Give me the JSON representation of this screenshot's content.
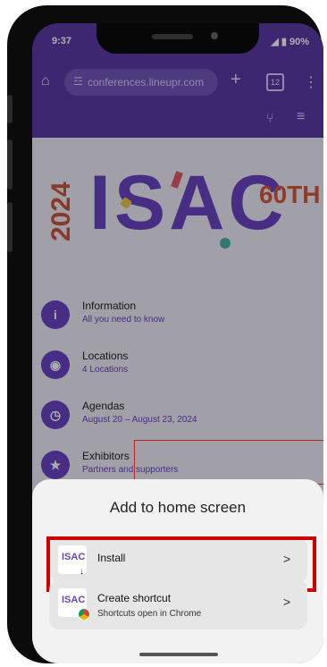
{
  "status": {
    "time": "9:37",
    "battery": "◢ ▮ 90%"
  },
  "chrome": {
    "home_icon": "⌂",
    "tune_icon": "☲",
    "url": "conferences.lineupr.com",
    "new_tab_icon": "+",
    "tab_count": "12",
    "menu_icon": "⋮"
  },
  "site": {
    "share_icon": "⑂",
    "menu_icon": "≡"
  },
  "hero": {
    "year": "2024",
    "title": "ISAC",
    "badge": "60TH"
  },
  "list": [
    {
      "title": "Information",
      "subtitle": "All you need to know",
      "icon": "i"
    },
    {
      "title": "Locations",
      "subtitle": "4 Locations",
      "icon": "◉"
    },
    {
      "title": "Agendas",
      "subtitle": "August 20 – August 23, 2024",
      "icon": "◷"
    },
    {
      "title": "Exhibitors",
      "subtitle": "Partners and supporters",
      "icon": "★"
    }
  ],
  "sheet": {
    "title": "Add to home screen",
    "install_label": "Install",
    "install_logo_text": "ISAC",
    "install_badge": "↓",
    "shortcut_label": "Create shortcut",
    "shortcut_sub": "Shortcuts open in Chrome",
    "chevron": ">"
  }
}
